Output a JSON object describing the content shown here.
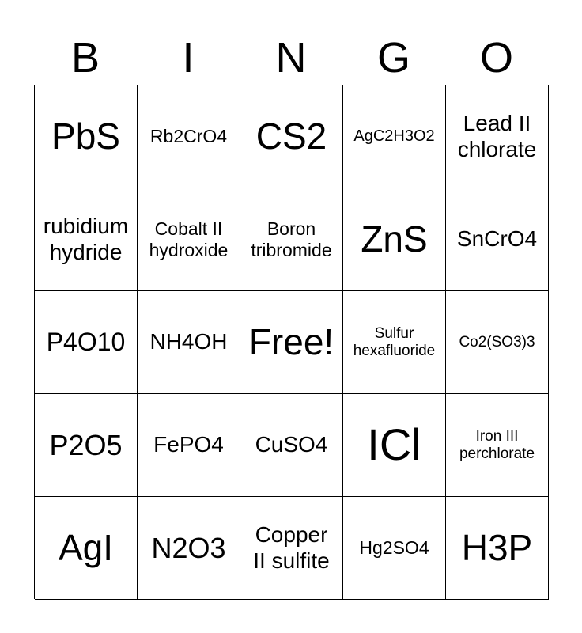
{
  "header": {
    "letters": [
      "B",
      "I",
      "N",
      "G",
      "O"
    ]
  },
  "board": {
    "rows": [
      [
        "PbS",
        "Rb2CrO4",
        "CS2",
        "AgC2H3O2",
        "Lead II chlorate"
      ],
      [
        "rubidium hydride",
        "Cobalt II hydroxide",
        "Boron tribromide",
        "ZnS",
        "SnCrO4"
      ],
      [
        "P4O10",
        "NH4OH",
        "Free!",
        "Sulfur hexafluoride",
        "Co2(SO3)3"
      ],
      [
        "P2O5",
        "FePO4",
        "CuSO4",
        "ICl",
        "Iron III perchlorate"
      ],
      [
        "AgI",
        "N2O3",
        "Copper II sulfite",
        "Hg2SO4",
        "H3P"
      ]
    ]
  }
}
